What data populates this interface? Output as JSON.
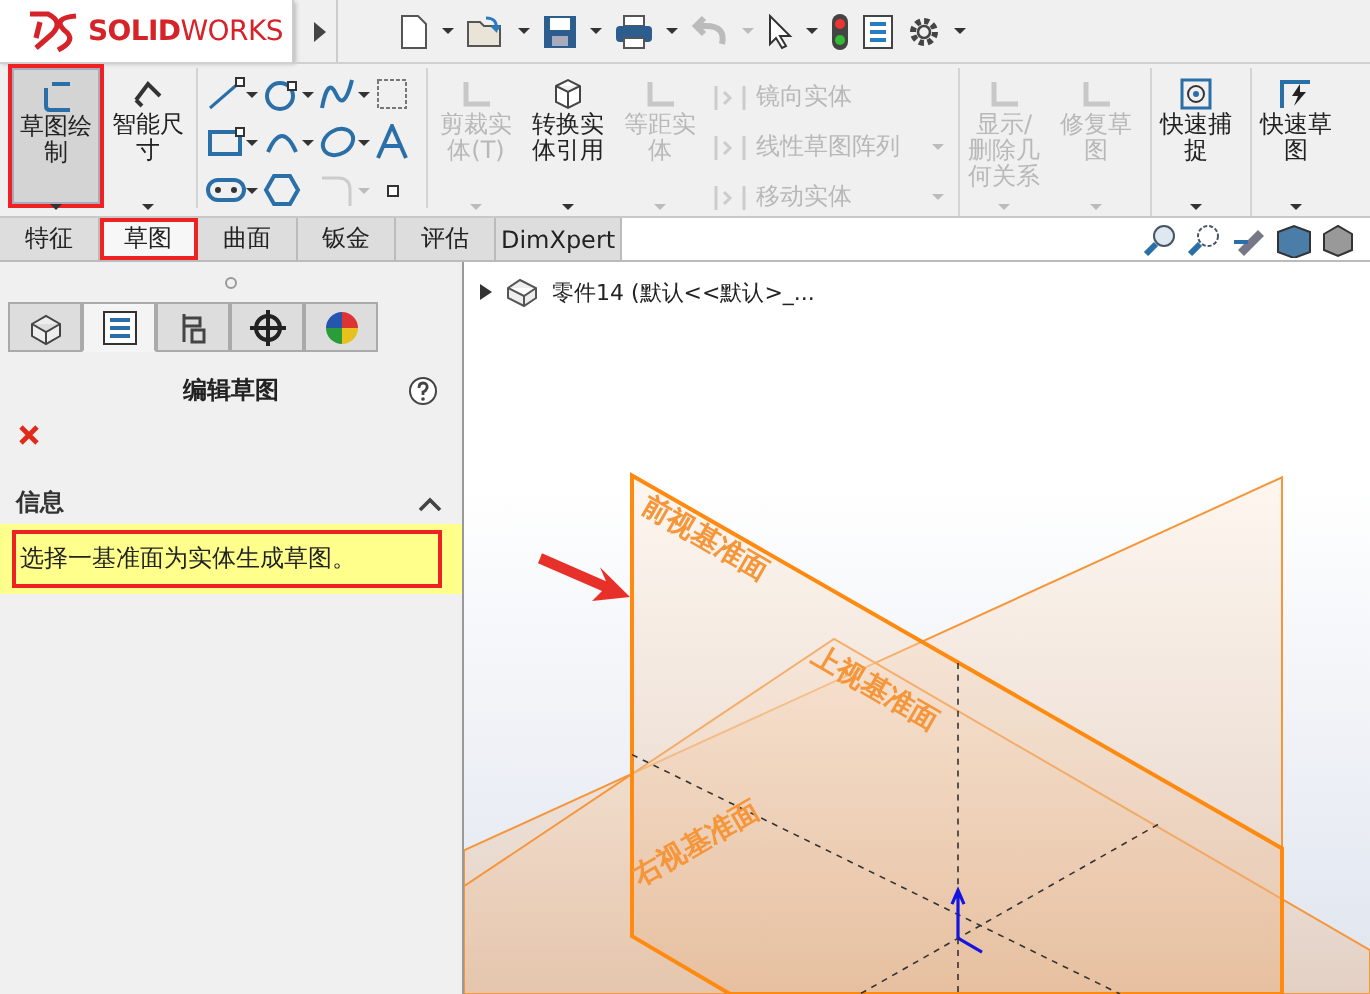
{
  "title_bar": {
    "logo": "**SOLID**WORKS"
  },
  "command_manager": {
    "commands": [
      {
        "kind": "big",
        "label": "草图绘制",
        "disabled": false,
        "highlighted": true
      },
      {
        "kind": "big",
        "label": "智能尺寸",
        "disabled": false,
        "highlighted": false
      },
      {
        "kind": "tools"
      },
      {
        "kind": "big",
        "label": "剪裁实体(T)",
        "disabled": true,
        "highlighted": false
      },
      {
        "kind": "big",
        "label": "转换实体引用",
        "disabled": false,
        "highlighted": false
      },
      {
        "kind": "big",
        "label": "等距实体",
        "disabled": true,
        "highlighted": false
      },
      {
        "kind": "stack",
        "items": [
          {
            "label": "镜向实体",
            "disabled": true
          },
          {
            "label": "线性草图阵列",
            "disabled": true
          },
          {
            "label": "移动实体",
            "disabled": true
          }
        ]
      },
      {
        "kind": "big",
        "label": "显示/删除几何关系",
        "disabled": true,
        "highlighted": false
      },
      {
        "kind": "big",
        "label": "修复草图",
        "disabled": true,
        "highlighted": false
      },
      {
        "kind": "big",
        "label": "快速捕捉",
        "disabled": false,
        "highlighted": false
      },
      {
        "kind": "big",
        "label": "快速草图",
        "disabled": false,
        "highlighted": false
      }
    ]
  },
  "tabs": [
    {
      "label": "特征",
      "selected": false,
      "highlighted": false
    },
    {
      "label": "草图",
      "selected": true,
      "highlighted": true
    },
    {
      "label": "曲面",
      "selected": false,
      "highlighted": false
    },
    {
      "label": "钣金",
      "selected": false,
      "highlighted": false
    },
    {
      "label": "评估",
      "selected": false,
      "highlighted": false
    },
    {
      "label": "DimXpert",
      "selected": false,
      "highlighted": false
    }
  ],
  "panel": {
    "tabs": [
      {
        "selected": false
      },
      {
        "selected": true
      },
      {
        "selected": false
      },
      {
        "selected": false
      },
      {
        "selected": false
      }
    ],
    "title": "编辑草图",
    "section": {
      "title": "信息",
      "expanded": true,
      "message": "选择一基准面为实体生成草图。",
      "highlighted": true
    }
  },
  "graphics": {
    "tree_root": "零件14 (默认<<默认>_...",
    "planes": [
      "前视基准面",
      "上视基准面",
      "右视基准面"
    ]
  }
}
